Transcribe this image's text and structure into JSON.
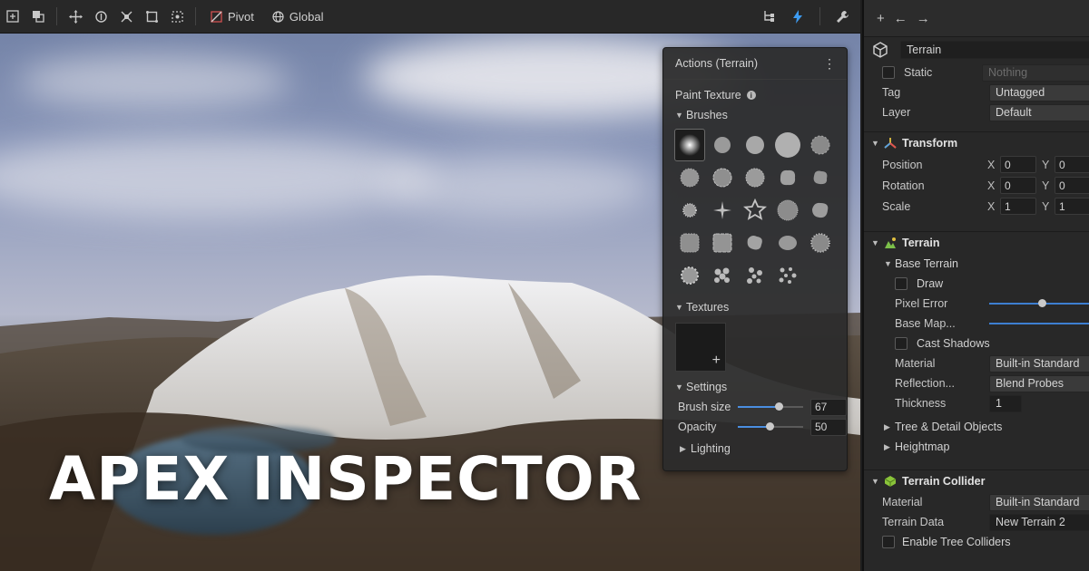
{
  "toolbar": {
    "pivot_label": "Pivot",
    "global_label": "Global"
  },
  "hero": {
    "title": "APEX INSPECTOR"
  },
  "actions_panel": {
    "title": "Actions (Terrain)",
    "tool": "Paint Texture",
    "brushes_label": "Brushes",
    "textures_label": "Textures",
    "settings_label": "Settings",
    "brush_size_label": "Brush size",
    "brush_size_value": "67",
    "brush_size_fraction": 0.63,
    "opacity_label": "Opacity",
    "opacity_value": "50",
    "opacity_fraction": 0.48,
    "lighting_label": "Lighting"
  },
  "inspector": {
    "object_name": "Terrain",
    "static_label": "Static",
    "static_value": "Nothing",
    "tag_label": "Tag",
    "tag_value": "Untagged",
    "layer_label": "Layer",
    "layer_value": "Default",
    "transform": {
      "title": "Transform",
      "position_label": "Position",
      "position_x": "0",
      "position_y": "0",
      "rotation_label": "Rotation",
      "rotation_x": "0",
      "rotation_y": "0",
      "scale_label": "Scale",
      "scale_x": "1",
      "scale_y": "1",
      "x_axis": "X",
      "y_axis": "Y"
    },
    "terrain": {
      "title": "Terrain",
      "base_terrain_label": "Base Terrain",
      "draw_label": "Draw",
      "pixel_error_label": "Pixel Error",
      "base_map_label": "Base Map...",
      "cast_shadows_label": "Cast Shadows",
      "material_label": "Material",
      "material_value": "Built-in Standard",
      "reflection_label": "Reflection...",
      "reflection_value": "Blend Probes",
      "thickness_label": "Thickness",
      "thickness_value": "1",
      "tree_detail_label": "Tree & Detail Objects",
      "heightmap_label": "Heightmap"
    },
    "collider": {
      "title": "Terrain Collider",
      "material_label": "Material",
      "material_value": "Built-in Standard",
      "terrain_data_label": "Terrain Data",
      "terrain_data_value": "New Terrain 2",
      "enable_tree_label": "Enable Tree Colliders"
    }
  },
  "colors": {
    "accent": "#4a8ee0",
    "transform_icon": "#e0c040",
    "terrain_icon": "#7cc04a",
    "collider_icon": "#8ac43a",
    "active_tool": "#3d9bf0"
  }
}
